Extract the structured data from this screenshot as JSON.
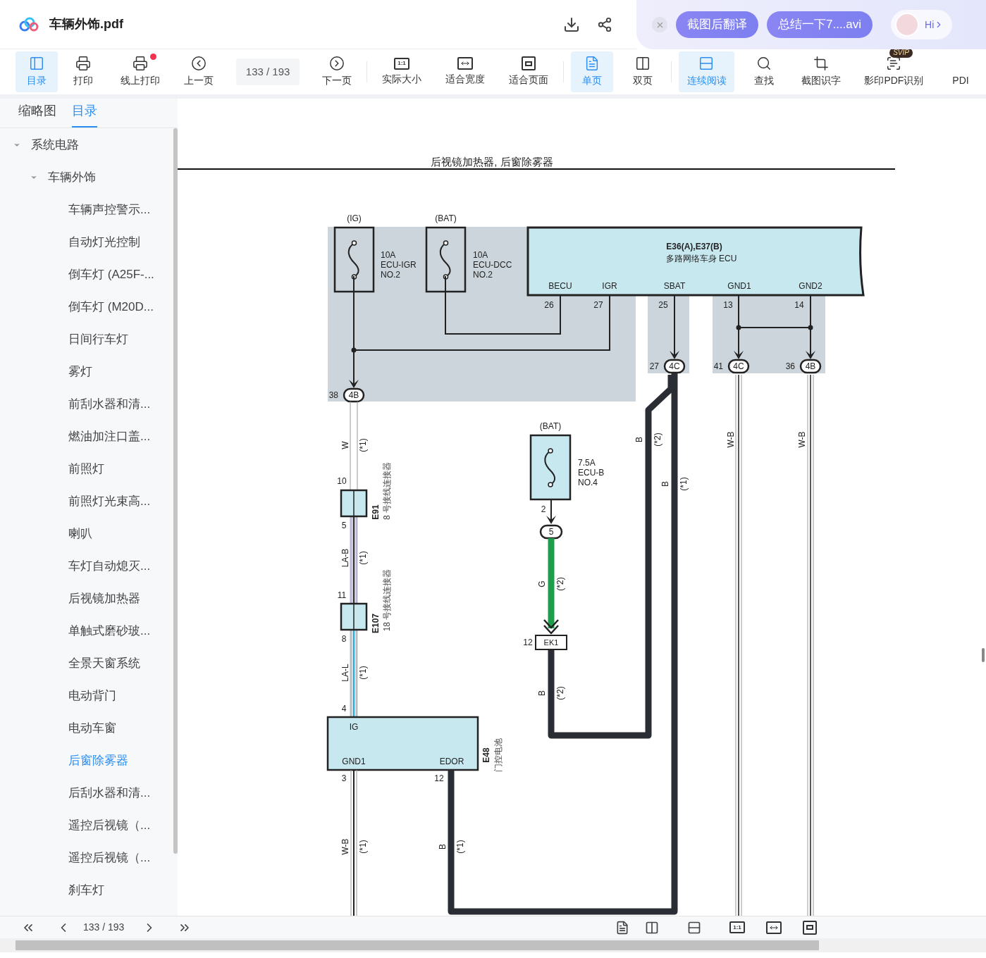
{
  "file": {
    "name": "车辆外饰.pdf"
  },
  "assistant": {
    "buttons": [
      "截图后翻译",
      "总结一下7....avi"
    ],
    "greeting": "Hi"
  },
  "toolbar": [
    {
      "kind": "button",
      "label": "目录",
      "selected": true
    },
    {
      "kind": "button",
      "label": "打印",
      "selected": false
    },
    {
      "kind": "button",
      "label": "线上打印",
      "selected": false,
      "notification": true
    },
    {
      "kind": "button",
      "label": "上一页",
      "selected": false
    },
    {
      "kind": "page",
      "label": "133 / 193"
    },
    {
      "kind": "button",
      "label": "下一页",
      "selected": false
    },
    {
      "kind": "button",
      "label": "实际大小",
      "selected": false,
      "glyph": "1:1"
    },
    {
      "kind": "button",
      "label": "适合宽度",
      "selected": false
    },
    {
      "kind": "button",
      "label": "适合页面",
      "selected": false
    },
    {
      "kind": "button",
      "label": "单页",
      "selected": true
    },
    {
      "kind": "button",
      "label": "双页",
      "selected": false
    },
    {
      "kind": "button",
      "label": "连续阅读",
      "selected": true
    },
    {
      "kind": "button",
      "label": "查找",
      "selected": false
    },
    {
      "kind": "button",
      "label": "截图识字",
      "selected": false
    },
    {
      "kind": "button",
      "label": "影印PDF识别",
      "selected": false,
      "badge": "SVIP"
    },
    {
      "kind": "button",
      "label": "PDI",
      "selected": false
    }
  ],
  "sidebar": {
    "tabs": [
      {
        "label": "缩略图",
        "selected": false
      },
      {
        "label": "目录",
        "selected": true
      }
    ],
    "tree": [
      {
        "label": "系统电路",
        "expanded": true,
        "selected": false,
        "children": [
          {
            "label": "车辆外饰",
            "expanded": true,
            "selected": false,
            "children": [
              {
                "label": "车辆声控警示...",
                "selected": false
              },
              {
                "label": "自动灯光控制",
                "selected": false
              },
              {
                "label": "倒车灯 (A25F-...",
                "selected": false
              },
              {
                "label": "倒车灯 (M20D...",
                "selected": false
              },
              {
                "label": "日间行车灯",
                "selected": false
              },
              {
                "label": "雾灯",
                "selected": false
              },
              {
                "label": "前刮水器和清...",
                "selected": false
              },
              {
                "label": "燃油加注口盖...",
                "selected": false
              },
              {
                "label": "前照灯",
                "selected": false
              },
              {
                "label": "前照灯光束高...",
                "selected": false
              },
              {
                "label": "喇叭",
                "selected": false
              },
              {
                "label": "车灯自动熄灭...",
                "selected": false
              },
              {
                "label": "后视镜加热器",
                "selected": false
              },
              {
                "label": "单触式磨砂玻...",
                "selected": false
              },
              {
                "label": "全景天窗系统",
                "selected": false
              },
              {
                "label": "电动背门",
                "selected": false
              },
              {
                "label": "电动车窗",
                "selected": false
              },
              {
                "label": "后窗除雾器",
                "selected": true
              },
              {
                "label": "后刮水器和清...",
                "selected": false
              },
              {
                "label": "遥控后视镜（...",
                "selected": false
              },
              {
                "label": "遥控后视镜（...",
                "selected": false
              },
              {
                "label": "刹车灯",
                "selected": false
              }
            ]
          }
        ]
      }
    ]
  },
  "diagram": {
    "title": "后视镜加热器, 后窗除雾器",
    "fuses": [
      {
        "source": "(IG)",
        "lines": [
          "10A",
          "ECU-IGR",
          "NO.2"
        ]
      },
      {
        "source": "(BAT)",
        "lines": [
          "10A",
          "ECU-DCC",
          "NO.2"
        ]
      },
      {
        "source": "(BAT)",
        "lines": [
          "7.5A",
          "ECU-B",
          "NO.4"
        ],
        "pin": "2"
      }
    ],
    "ecu": {
      "code": "E36(A),E37(B)",
      "name": "多路网络车身 ECU",
      "pins": [
        {
          "name": "BECU",
          "number": "26"
        },
        {
          "name": "IGR",
          "number": "27"
        },
        {
          "name": "SBAT",
          "number": "25"
        },
        {
          "name": "GND1",
          "number": "13"
        },
        {
          "name": "GND2",
          "number": "14"
        }
      ]
    },
    "connectors": [
      {
        "pin": "27",
        "code": "4C"
      },
      {
        "pin": "41",
        "code": "4C"
      },
      {
        "pin": "36",
        "code": "4B"
      },
      {
        "pin": "38",
        "code": "4B"
      }
    ],
    "splices": [
      {
        "code": "E91",
        "name": "8 号接线连接器",
        "pin_in": "10",
        "pin_out": "5"
      },
      {
        "code": "E107",
        "name": "18 号接线连接器",
        "pin_in": "11",
        "pin_out": "8"
      }
    ],
    "inline_connector": "5",
    "ek1": {
      "code": "EK1",
      "pin": "12"
    },
    "e48": {
      "code": "E48",
      "name": "门控电池",
      "pins": [
        {
          "name": "IG",
          "number": "4"
        },
        {
          "name": "GND1",
          "number": "3"
        },
        {
          "name": "EDOR",
          "number": "12"
        }
      ]
    },
    "wires": [
      {
        "code": "W",
        "note": "(*1)"
      },
      {
        "code": "LA-B",
        "note": "(*1)"
      },
      {
        "code": "LA-L",
        "note": "(*1)"
      },
      {
        "code": "W-B",
        "note": "(*1)"
      },
      {
        "code": "B",
        "note": "(*1)"
      },
      {
        "code": "G",
        "note": "(*2)"
      },
      {
        "code": "B",
        "note": "(*2)"
      },
      {
        "code": "B",
        "note": "(*2)"
      },
      {
        "code": "B",
        "note": "(*1)"
      },
      {
        "code": "W-B"
      },
      {
        "code": "W-B"
      }
    ]
  },
  "footer": {
    "page": "133 / 193",
    "glyph": "1:1"
  }
}
